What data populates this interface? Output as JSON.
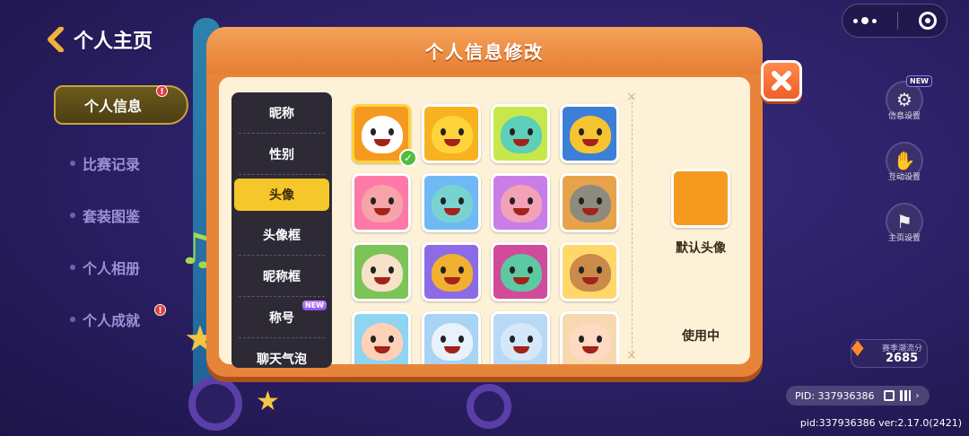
{
  "page": {
    "title": "个人主页"
  },
  "side_nav": {
    "items": [
      {
        "label": "个人信息",
        "active": true,
        "alert": true
      },
      {
        "label": "比赛记录",
        "active": false,
        "alert": false
      },
      {
        "label": "套装图鉴",
        "active": false,
        "alert": false
      },
      {
        "label": "个人相册",
        "active": false,
        "alert": false
      },
      {
        "label": "个人成就",
        "active": false,
        "alert": true
      }
    ],
    "alert_glyph": "!"
  },
  "modal": {
    "title": "个人信息修改",
    "categories": [
      {
        "label": "昵称"
      },
      {
        "label": "性别"
      },
      {
        "label": "头像",
        "active": true
      },
      {
        "label": "头像框"
      },
      {
        "label": "昵称框"
      },
      {
        "label": "称号",
        "badge": "NEW"
      },
      {
        "label": "聊天气泡"
      }
    ],
    "preview": {
      "label": "默认头像",
      "status": "使用中"
    }
  },
  "avatars": [
    {
      "name": "avatar-default-white",
      "bg": "#f59a1f",
      "face": "#ffffff",
      "selected": true
    },
    {
      "name": "avatar-yellow-star",
      "bg": "#f8b21f",
      "face": "#ffd43b"
    },
    {
      "name": "avatar-teal-laugh",
      "bg": "#c6e84a",
      "face": "#5fd0b8"
    },
    {
      "name": "avatar-yellow-cry",
      "bg": "#3c7fd6",
      "face": "#f6c431"
    },
    {
      "name": "avatar-pink-shy",
      "bg": "#ff79a8",
      "face": "#f7a4a8"
    },
    {
      "name": "avatar-teal-sad",
      "bg": "#6fb9f5",
      "face": "#78d3d0"
    },
    {
      "name": "avatar-pink-crown",
      "bg": "#c97de6",
      "face": "#f3a1b8"
    },
    {
      "name": "avatar-grey-fin",
      "bg": "#e8a24a",
      "face": "#8e8a7e"
    },
    {
      "name": "avatar-cream-tongue",
      "bg": "#7cc458",
      "face": "#f5e2c8"
    },
    {
      "name": "avatar-orange-grin",
      "bg": "#8d6ae6",
      "face": "#f2b031"
    },
    {
      "name": "avatar-teal-grin",
      "bg": "#d24a9a",
      "face": "#5cc9a2"
    },
    {
      "name": "avatar-sunglasses",
      "bg": "#ffd76a",
      "face": "#c98a4a"
    },
    {
      "name": "avatar-girl-hat",
      "bg": "#8fd4f0",
      "face": "#ffd2b8"
    },
    {
      "name": "avatar-snow-bunny",
      "bg": "#a9d3f2",
      "face": "#e8f2fb"
    },
    {
      "name": "avatar-snow-dino",
      "bg": "#b8d9f5",
      "face": "#d5e8fa"
    },
    {
      "name": "avatar-fox-girl",
      "bg": "#f7d9b0",
      "face": "#ffd9c2"
    }
  ],
  "right_panel": {
    "buttons": [
      {
        "label": "信息设置",
        "icon": "gear-icon",
        "new": "NEW"
      },
      {
        "label": "互动设置",
        "icon": "hand-icon"
      },
      {
        "label": "主页设置",
        "icon": "flag-icon"
      }
    ],
    "season": {
      "label": "赛季潮流分",
      "value": "2685"
    }
  },
  "pid_box": {
    "text": "PID: 337936386"
  },
  "version": "pid:337936386 ver:2.17.0(2421)",
  "colors": {
    "modal": "#e8843a",
    "modal_body": "#fdf1d8",
    "active_category": "#f5c72b",
    "check": "#4cbf3f"
  }
}
